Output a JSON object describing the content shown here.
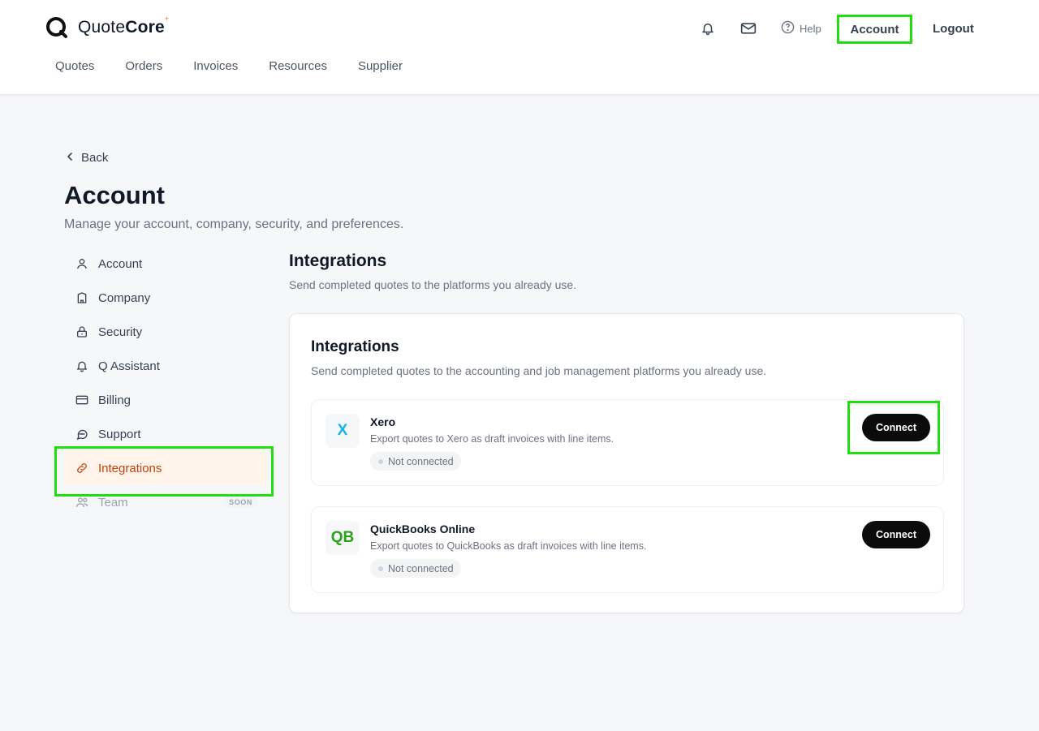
{
  "brand": {
    "name_light": "Quote",
    "name_bold": "Core",
    "sup": "+"
  },
  "topnav": [
    "Quotes",
    "Orders",
    "Invoices",
    "Resources",
    "Supplier"
  ],
  "header": {
    "help_label": "Help",
    "account_label": "Account",
    "logout_label": "Logout"
  },
  "page": {
    "back_label": "Back",
    "title": "Account",
    "subtitle": "Manage your account, company, security, and preferences."
  },
  "sidebar": {
    "items": [
      {
        "label": "Account"
      },
      {
        "label": "Company"
      },
      {
        "label": "Security"
      },
      {
        "label": "Q Assistant"
      },
      {
        "label": "Billing"
      },
      {
        "label": "Support"
      },
      {
        "label": "Integrations"
      },
      {
        "label": "Team",
        "badge": "SOON"
      }
    ]
  },
  "main": {
    "title": "Integrations",
    "subtitle": "Send completed quotes to the platforms you already use.",
    "card": {
      "title": "Integrations",
      "subtitle": "Send completed quotes to the accounting and job management platforms you already use.",
      "integrations": [
        {
          "logo": "X",
          "logo_color": "#13b5ea",
          "name": "Xero",
          "description": "Export quotes to Xero as draft invoices with line items.",
          "status": "Not connected",
          "action": "Connect"
        },
        {
          "logo": "QB",
          "logo_color": "#2ca01c",
          "name": "QuickBooks Online",
          "description": "Export quotes to QuickBooks as draft invoices with line items.",
          "status": "Not connected",
          "action": "Connect"
        }
      ]
    }
  },
  "colors": {
    "active_bg": "#fff3ea",
    "active_text": "#c2410c",
    "highlight": "#22dd11",
    "brand_accent": "#f97316"
  }
}
